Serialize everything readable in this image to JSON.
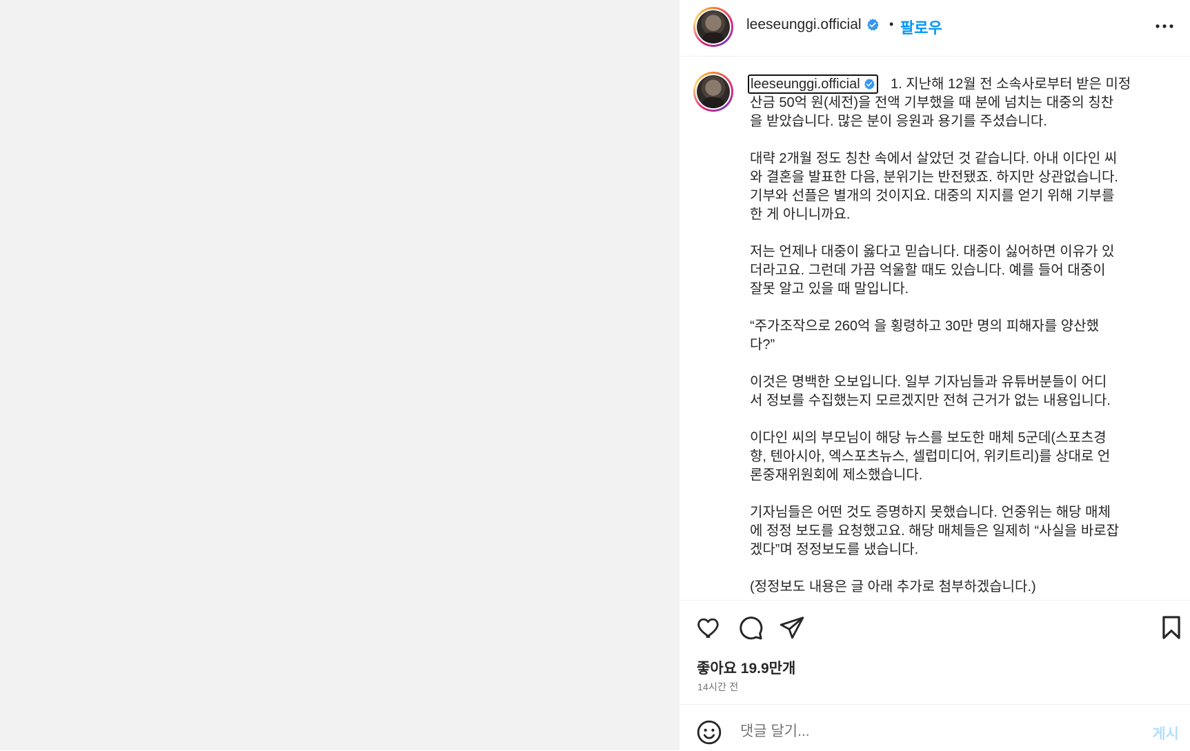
{
  "header": {
    "username": "leeseunggi.official",
    "separator": "•",
    "follow_label": "팔로우"
  },
  "caption": {
    "username": "leeseunggi.official",
    "first_line": "1. 지난해 12월 전 소속사로부터 받은 미정",
    "body": "산금 50억 원(세전)을 전액 기부했을 때 분에 넘치는 대중의 칭찬\n을 받았습니다. 많은 분이 응원과 용기를 주셨습니다.\n\n대략 2개월 정도 칭찬 속에서 살았던 것 같습니다. 아내 이다인 씨\n와 결혼을 발표한 다음, 분위기는 반전됐죠. 하지만 상관없습니다.\n기부와 선플은 별개의 것이지요. 대중의 지지를 얻기 위해 기부를\n한 게 아니니까요.\n\n저는 언제나 대중이 옳다고 믿습니다. 대중이 싫어하면 이유가 있\n더라고요. 그런데 가끔 억울할 때도 있습니다. 예를 들어 대중이\n잘못 알고 있을 때 말입니다.\n\n“주가조작으로 260억 을 횡령하고 30만 명의 피해자를 양산했\n다?”\n\n이것은 명백한 오보입니다. 일부 기자님들과 유튜버분들이 어디\n서 정보를 수집했는지 모르겠지만 전혀 근거가 없는 내용입니다.\n\n이다인 씨의 부모님이 해당 뉴스를 보도한 매체 5군데(스포츠경\n향, 텐아시아, 엑스포츠뉴스, 셀럽미디어, 위키트리)를 상대로 언\n론중재위원회에 제소했습니다.\n\n기자님들은 어떤 것도 증명하지 못했습니다. 언중위는 해당 매체\n에 정정 보도를 요청했고요. 해당 매체들은 일제히 “사실을 바로잡\n겠다”며 정정보도를 냈습니다.\n\n(정정보도 내용은 글 아래 추가로 첨부하겠습니다.)"
  },
  "actions": {
    "likes_text": "좋아요 19.9만개",
    "time_text": "14시간 전"
  },
  "comment": {
    "placeholder": "댓글 달기...",
    "post_label": "게시"
  },
  "colors": {
    "accent": "#0095f6",
    "post_disabled": "#b2dffc",
    "verified": "#3897f0",
    "media_bg": "#f2f2f2"
  },
  "icons": {
    "verified": "verified-badge-icon",
    "more": "more-options-icon",
    "like": "heart-icon",
    "comment": "comment-bubble-icon",
    "share": "paper-plane-icon",
    "save": "bookmark-icon",
    "emoji": "emoji-smile-icon"
  }
}
